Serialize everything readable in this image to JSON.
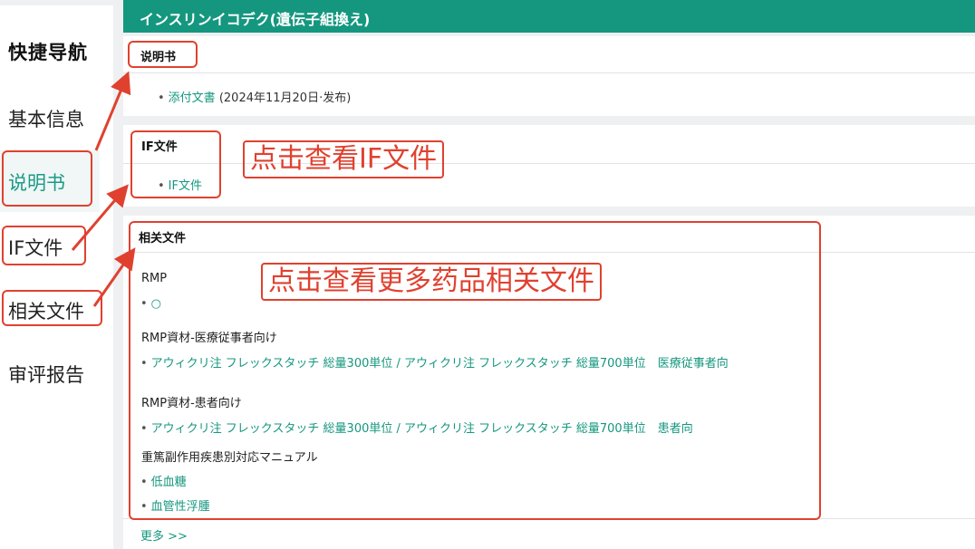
{
  "sidebar": {
    "title": "快捷导航",
    "items": [
      {
        "label": "基本信息"
      },
      {
        "label": "说明书"
      },
      {
        "label": "IF文件"
      },
      {
        "label": "相关文件"
      },
      {
        "label": "审评报告"
      }
    ]
  },
  "header": {
    "title": "インスリンイコデク(遺伝子組換え)"
  },
  "manual": {
    "title": "说明书",
    "link": "添付文書",
    "note": "(2024年11月20日·发布)"
  },
  "if_section": {
    "title": "IF文件",
    "link": "IF文件"
  },
  "related": {
    "title": "相关文件",
    "groups": [
      {
        "heading": "RMP",
        "links": [
          "○"
        ]
      },
      {
        "heading": "RMP資材-医療従事者向け",
        "links": [
          "アウィクリ注 フレックスタッチ 総量300単位 / アウィクリ注 フレックスタッチ 総量700単位　医療従事者向"
        ]
      },
      {
        "heading": "RMP資材-患者向け",
        "links": [
          "アウィクリ注 フレックスタッチ 総量300単位 / アウィクリ注 フレックスタッチ 総量700単位　患者向"
        ]
      },
      {
        "heading": "重篤副作用疾患別対応マニュアル",
        "links": [
          "低血糖",
          "血管性浮腫"
        ]
      }
    ],
    "more": "更多 >>"
  },
  "annotations": {
    "if_hint": "点击查看IF文件",
    "related_hint": "点击查看更多药品相关文件"
  },
  "colors": {
    "accent": "#15977f",
    "annotation": "#e0412f"
  }
}
